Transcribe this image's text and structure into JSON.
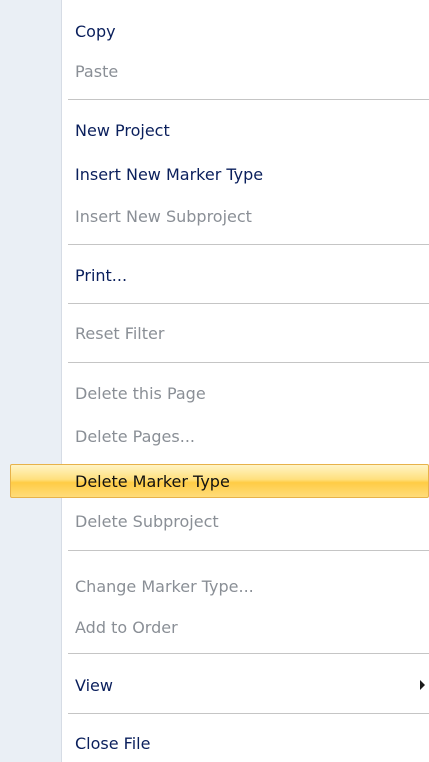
{
  "menu": {
    "items": [
      {
        "label": "Copy",
        "enabled": true
      },
      {
        "label": "Paste",
        "enabled": false
      },
      {
        "label": "New Project",
        "enabled": true
      },
      {
        "label": "Insert New Marker Type",
        "enabled": true
      },
      {
        "label": "Insert New Subproject",
        "enabled": false
      },
      {
        "label": "Print...",
        "enabled": true
      },
      {
        "label": "Reset Filter",
        "enabled": false
      },
      {
        "label": "Delete this Page",
        "enabled": false
      },
      {
        "label": "Delete Pages...",
        "enabled": false
      },
      {
        "label": "Delete Marker Type",
        "enabled": true,
        "highlighted": true
      },
      {
        "label": "Delete Subproject",
        "enabled": false
      },
      {
        "label": "Change Marker Type...",
        "enabled": false
      },
      {
        "label": "Add to Order",
        "enabled": false
      },
      {
        "label": "View",
        "enabled": true,
        "submenu": true
      },
      {
        "label": "Close File",
        "enabled": true
      }
    ]
  },
  "colors": {
    "enabled_text": "#0a1f5c",
    "disabled_text": "#8a8f96",
    "highlight": "#ffd75e",
    "gutter": "#eaeff5"
  }
}
